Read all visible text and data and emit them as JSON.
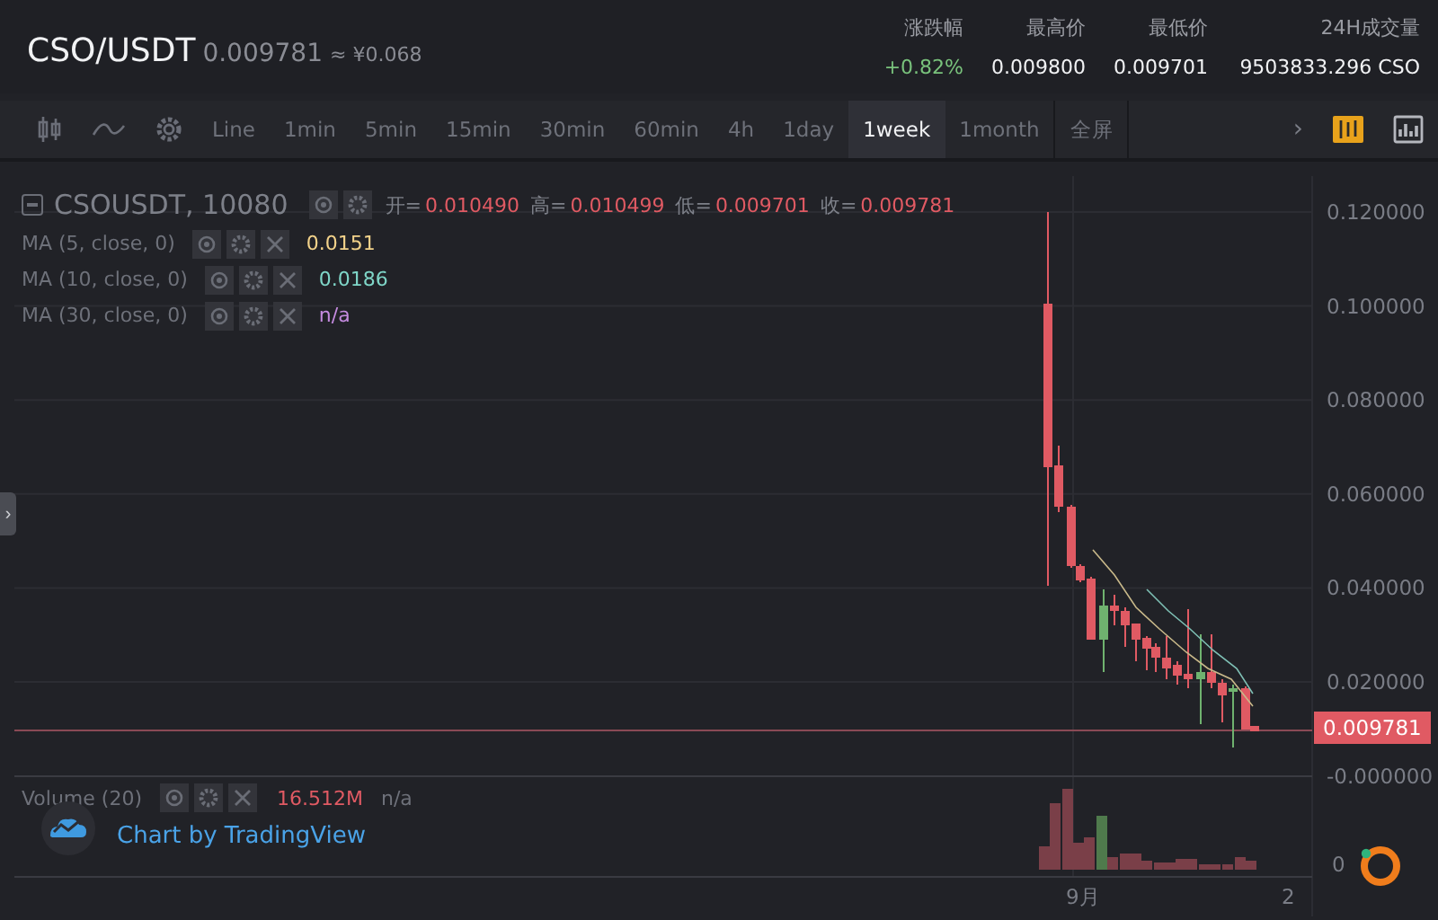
{
  "header": {
    "pair": "CSO/USDT",
    "price": "0.009781",
    "approx": "≈ ¥0.068"
  },
  "stats": [
    {
      "label": "涨跌幅",
      "value": "+0.82%",
      "kind": "change"
    },
    {
      "label": "最高价",
      "value": "0.009800",
      "kind": "plain"
    },
    {
      "label": "最低价",
      "value": "0.009701",
      "kind": "plain"
    },
    {
      "label": "24H成交量",
      "value": "9503833.296 CSO",
      "kind": "plain"
    }
  ],
  "toolbar": {
    "intervals": [
      {
        "label": "Line",
        "selected": false
      },
      {
        "label": "1min",
        "selected": false
      },
      {
        "label": "5min",
        "selected": false
      },
      {
        "label": "15min",
        "selected": false
      },
      {
        "label": "30min",
        "selected": false
      },
      {
        "label": "60min",
        "selected": false
      },
      {
        "label": "4h",
        "selected": false
      },
      {
        "label": "1day",
        "selected": false
      },
      {
        "label": "1week",
        "selected": true
      },
      {
        "label": "1month",
        "selected": false
      }
    ],
    "fullscreen": "全屏",
    "more": "›"
  },
  "chart": {
    "symbol": "CSOUSDT, 10080",
    "ohlc": [
      {
        "label": "开=",
        "value": "0.010490"
      },
      {
        "label": "高=",
        "value": "0.010499"
      },
      {
        "label": "低=",
        "value": "0.009701"
      },
      {
        "label": "收=",
        "value": "0.009781"
      }
    ],
    "indicators": [
      {
        "name": "MA (5, close, 0)",
        "value": "0.0151",
        "color": "#f2d28a"
      },
      {
        "name": "MA (10, close, 0)",
        "value": "0.0186",
        "color": "#7fd6c8"
      },
      {
        "name": "MA (30, close, 0)",
        "value": "n/a",
        "color": "#c58be0"
      }
    ],
    "price_ticks": [
      "0.120000",
      "0.100000",
      "0.080000",
      "0.060000",
      "0.040000",
      "0.020000",
      "-0.000000"
    ],
    "last_price": "0.009781",
    "volume": {
      "name": "Volume (20)",
      "value": "16.512M",
      "ma": "n/a"
    },
    "volume_tick": "0",
    "time_labels": [
      "9月",
      "2"
    ],
    "side_toggle": "›",
    "credit": "Chart by TradingView"
  }
}
